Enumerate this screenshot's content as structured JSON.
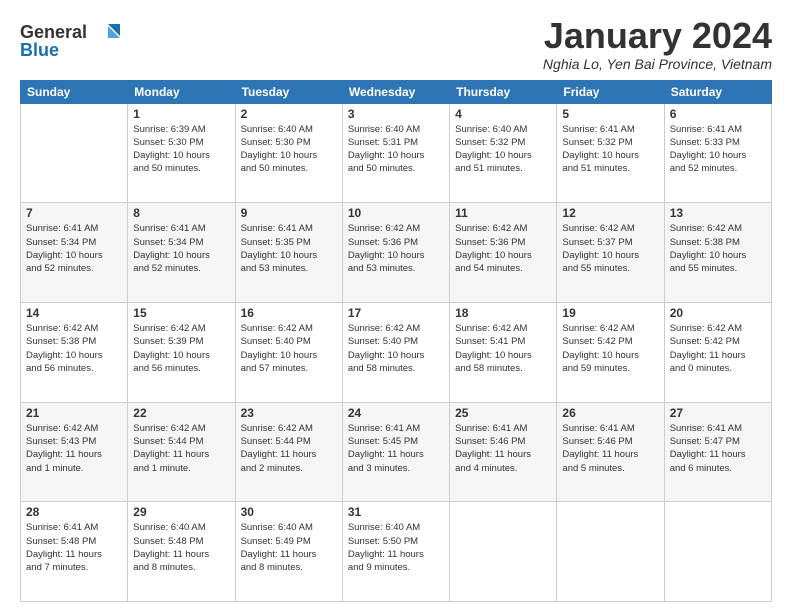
{
  "header": {
    "logo_line1": "General",
    "logo_line2": "Blue",
    "title": "January 2024",
    "location": "Nghia Lo, Yen Bai Province, Vietnam"
  },
  "days_of_week": [
    "Sunday",
    "Monday",
    "Tuesday",
    "Wednesday",
    "Thursday",
    "Friday",
    "Saturday"
  ],
  "weeks": [
    [
      {
        "day": "",
        "info": ""
      },
      {
        "day": "1",
        "info": "Sunrise: 6:39 AM\nSunset: 5:30 PM\nDaylight: 10 hours\nand 50 minutes."
      },
      {
        "day": "2",
        "info": "Sunrise: 6:40 AM\nSunset: 5:30 PM\nDaylight: 10 hours\nand 50 minutes."
      },
      {
        "day": "3",
        "info": "Sunrise: 6:40 AM\nSunset: 5:31 PM\nDaylight: 10 hours\nand 50 minutes."
      },
      {
        "day": "4",
        "info": "Sunrise: 6:40 AM\nSunset: 5:32 PM\nDaylight: 10 hours\nand 51 minutes."
      },
      {
        "day": "5",
        "info": "Sunrise: 6:41 AM\nSunset: 5:32 PM\nDaylight: 10 hours\nand 51 minutes."
      },
      {
        "day": "6",
        "info": "Sunrise: 6:41 AM\nSunset: 5:33 PM\nDaylight: 10 hours\nand 52 minutes."
      }
    ],
    [
      {
        "day": "7",
        "info": "Sunrise: 6:41 AM\nSunset: 5:34 PM\nDaylight: 10 hours\nand 52 minutes."
      },
      {
        "day": "8",
        "info": "Sunrise: 6:41 AM\nSunset: 5:34 PM\nDaylight: 10 hours\nand 52 minutes."
      },
      {
        "day": "9",
        "info": "Sunrise: 6:41 AM\nSunset: 5:35 PM\nDaylight: 10 hours\nand 53 minutes."
      },
      {
        "day": "10",
        "info": "Sunrise: 6:42 AM\nSunset: 5:36 PM\nDaylight: 10 hours\nand 53 minutes."
      },
      {
        "day": "11",
        "info": "Sunrise: 6:42 AM\nSunset: 5:36 PM\nDaylight: 10 hours\nand 54 minutes."
      },
      {
        "day": "12",
        "info": "Sunrise: 6:42 AM\nSunset: 5:37 PM\nDaylight: 10 hours\nand 55 minutes."
      },
      {
        "day": "13",
        "info": "Sunrise: 6:42 AM\nSunset: 5:38 PM\nDaylight: 10 hours\nand 55 minutes."
      }
    ],
    [
      {
        "day": "14",
        "info": "Sunrise: 6:42 AM\nSunset: 5:38 PM\nDaylight: 10 hours\nand 56 minutes."
      },
      {
        "day": "15",
        "info": "Sunrise: 6:42 AM\nSunset: 5:39 PM\nDaylight: 10 hours\nand 56 minutes."
      },
      {
        "day": "16",
        "info": "Sunrise: 6:42 AM\nSunset: 5:40 PM\nDaylight: 10 hours\nand 57 minutes."
      },
      {
        "day": "17",
        "info": "Sunrise: 6:42 AM\nSunset: 5:40 PM\nDaylight: 10 hours\nand 58 minutes."
      },
      {
        "day": "18",
        "info": "Sunrise: 6:42 AM\nSunset: 5:41 PM\nDaylight: 10 hours\nand 58 minutes."
      },
      {
        "day": "19",
        "info": "Sunrise: 6:42 AM\nSunset: 5:42 PM\nDaylight: 10 hours\nand 59 minutes."
      },
      {
        "day": "20",
        "info": "Sunrise: 6:42 AM\nSunset: 5:42 PM\nDaylight: 11 hours\nand 0 minutes."
      }
    ],
    [
      {
        "day": "21",
        "info": "Sunrise: 6:42 AM\nSunset: 5:43 PM\nDaylight: 11 hours\nand 1 minute."
      },
      {
        "day": "22",
        "info": "Sunrise: 6:42 AM\nSunset: 5:44 PM\nDaylight: 11 hours\nand 1 minute."
      },
      {
        "day": "23",
        "info": "Sunrise: 6:42 AM\nSunset: 5:44 PM\nDaylight: 11 hours\nand 2 minutes."
      },
      {
        "day": "24",
        "info": "Sunrise: 6:41 AM\nSunset: 5:45 PM\nDaylight: 11 hours\nand 3 minutes."
      },
      {
        "day": "25",
        "info": "Sunrise: 6:41 AM\nSunset: 5:46 PM\nDaylight: 11 hours\nand 4 minutes."
      },
      {
        "day": "26",
        "info": "Sunrise: 6:41 AM\nSunset: 5:46 PM\nDaylight: 11 hours\nand 5 minutes."
      },
      {
        "day": "27",
        "info": "Sunrise: 6:41 AM\nSunset: 5:47 PM\nDaylight: 11 hours\nand 6 minutes."
      }
    ],
    [
      {
        "day": "28",
        "info": "Sunrise: 6:41 AM\nSunset: 5:48 PM\nDaylight: 11 hours\nand 7 minutes."
      },
      {
        "day": "29",
        "info": "Sunrise: 6:40 AM\nSunset: 5:48 PM\nDaylight: 11 hours\nand 8 minutes."
      },
      {
        "day": "30",
        "info": "Sunrise: 6:40 AM\nSunset: 5:49 PM\nDaylight: 11 hours\nand 8 minutes."
      },
      {
        "day": "31",
        "info": "Sunrise: 6:40 AM\nSunset: 5:50 PM\nDaylight: 11 hours\nand 9 minutes."
      },
      {
        "day": "",
        "info": ""
      },
      {
        "day": "",
        "info": ""
      },
      {
        "day": "",
        "info": ""
      }
    ]
  ]
}
